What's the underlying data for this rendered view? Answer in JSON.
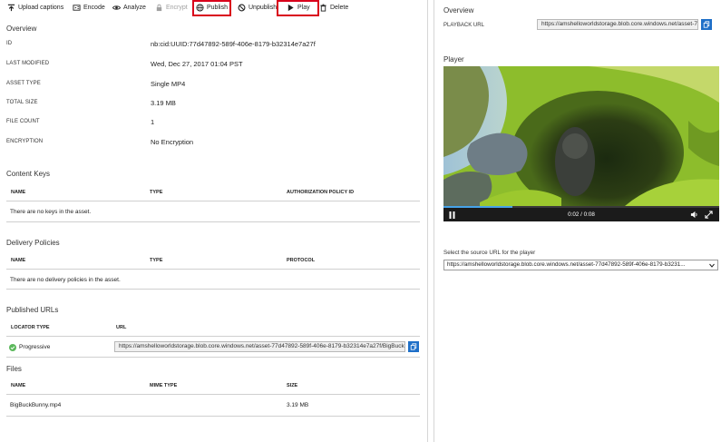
{
  "toolbar": {
    "upload_captions": "Upload captions",
    "encode": "Encode",
    "analyze": "Analyze",
    "encrypt": "Encrypt",
    "publish": "Publish",
    "unpublish": "Unpublish",
    "play": "Play",
    "delete": "Delete"
  },
  "overview": {
    "title": "Overview",
    "properties": [
      {
        "label": "ID",
        "value": "nb:cid:UUID:77d47892-589f-406e-8179-b32314e7a27f"
      },
      {
        "label": "LAST MODIFIED",
        "value": "Wed, Dec 27, 2017 01:04 PST"
      },
      {
        "label": "ASSET TYPE",
        "value": "Single MP4"
      },
      {
        "label": "TOTAL SIZE",
        "value": "3.19 MB"
      },
      {
        "label": "FILE COUNT",
        "value": "1"
      },
      {
        "label": "ENCRYPTION",
        "value": "No Encryption"
      }
    ]
  },
  "content_keys": {
    "title": "Content Keys",
    "columns": [
      "NAME",
      "TYPE",
      "AUTHORIZATION POLICY ID"
    ],
    "empty": "There are no keys in the asset."
  },
  "delivery_policies": {
    "title": "Delivery Policies",
    "columns": [
      "NAME",
      "TYPE",
      "PROTOCOL"
    ],
    "empty": "There are no delivery policies in the asset."
  },
  "published_urls": {
    "title": "Published URLs",
    "columns": [
      "LOCATOR TYPE",
      "URL"
    ],
    "row": {
      "locator_type": "Progressive",
      "url": "https://amshelloworldstorage.blob.core.windows.net/asset-77d47892-589f-406e-8179-b32314e7a27f/BigBuckBunny.mp4?sv=2015-07-08"
    }
  },
  "files": {
    "title": "Files",
    "columns": [
      "NAME",
      "MIME TYPE",
      "SIZE"
    ],
    "rows": [
      {
        "name": "BigBuckBunny.mp4",
        "mime": "",
        "size": "3.19 MB"
      }
    ]
  },
  "right_overview": {
    "title": "Overview",
    "playback_label": "PLAYBACK URL",
    "playback_url": "https://amshelloworldstorage.blob.core.windows.net/asset-77d47892"
  },
  "player": {
    "title": "Player",
    "time": "0:02 / 0:08",
    "progress": 0.25
  },
  "source_select": {
    "label": "Select the source URL for the player",
    "value": "https://amshelloworldstorage.blob.core.windows.net/asset-77d47892-589f-406e-8179-b3231..."
  },
  "colors": {
    "highlight": "#d9001b",
    "accent": "#1e6fc8",
    "progress": "#47a3e8",
    "status_ok": "#5cb85c"
  }
}
